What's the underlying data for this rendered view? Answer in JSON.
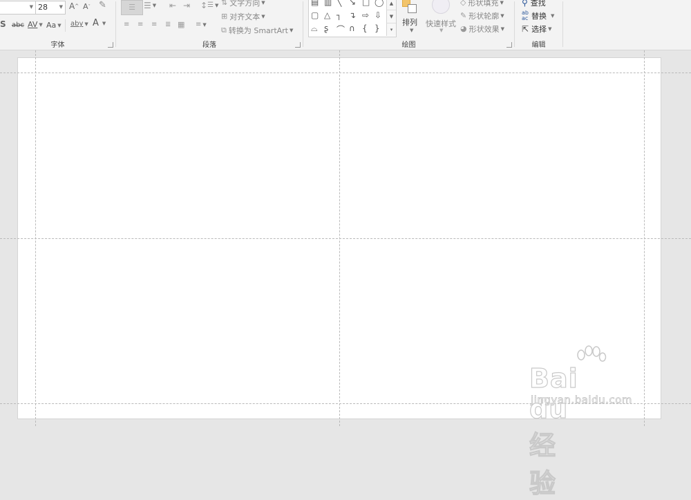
{
  "font_group": {
    "label": "字体",
    "size_value": "28",
    "grow_glyph": "A",
    "shrink_glyph": "A",
    "s_glyph": "S",
    "strike_label": "abc",
    "spacing_label": "AV",
    "case_label": "Aa",
    "highlight_label": "aby",
    "font_color_glyph": "A"
  },
  "paragraph_group": {
    "label": "段落",
    "text_direction": "文字方向",
    "align_text": "对齐文本",
    "convert_smartart": "转换为 SmartArt"
  },
  "drawing_group": {
    "label": "绘图",
    "arrange": "排列",
    "quick_styles": "快速样式",
    "shape_fill": "形状填充",
    "shape_outline": "形状轮廓",
    "shape_effects": "形状效果"
  },
  "editing_group": {
    "label": "编辑",
    "find": "查找",
    "replace": "替换",
    "select": "选择"
  },
  "watermark": {
    "logo": "Bai du 经验",
    "url": "jingyan.baidu.com"
  },
  "icons": [
    "font-grow-icon",
    "font-shrink-icon",
    "clear-format-icon",
    "bullets-icon",
    "numbering-icon",
    "decrease-indent-icon",
    "increase-indent-icon",
    "line-spacing-icon",
    "align-left-icon",
    "align-center-icon",
    "align-right-icon",
    "justify-icon",
    "columns-icon",
    "text-direction-icon",
    "align-text-icon",
    "smartart-icon",
    "arrange-icon",
    "quick-styles-icon",
    "fill-icon",
    "outline-icon",
    "effects-icon",
    "find-icon",
    "replace-icon",
    "select-icon"
  ],
  "colors": {
    "ribbon_bg": "#f3f3f3",
    "workspace_bg": "#e6e6e6",
    "slide_bg": "#ffffff",
    "guide": "#b9b9b9"
  }
}
